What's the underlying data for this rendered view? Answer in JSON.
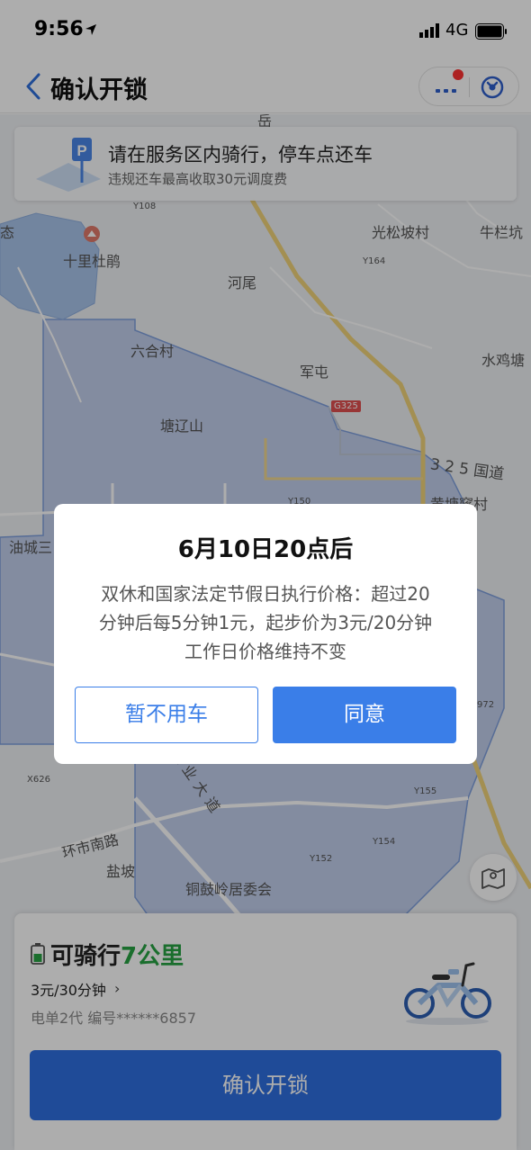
{
  "status_bar": {
    "time": "9:56",
    "network": "4G"
  },
  "nav": {
    "title": "确认开锁"
  },
  "banner": {
    "title": "请在服务区内骑行，停车点还车",
    "subtitle": "违规还车最高收取30元调度费"
  },
  "map": {
    "labels": [
      "十里杜鹃",
      "光松坡村",
      "牛栏坑",
      "河尾",
      "六合村",
      "军屯",
      "水鸡塘",
      "塘辽山",
      "油城三",
      "黄塘窿村",
      "环市南路",
      "盐坡",
      "铜鼓岭居委会",
      "工业大道",
      "3 2 5 国道",
      "态",
      "岳"
    ],
    "road_badges": [
      "Y108",
      "Y164",
      "G325",
      "Y150",
      "X626",
      "Y155",
      "Y154",
      "Y152",
      "972"
    ]
  },
  "sheet": {
    "range_prefix": "可骑行",
    "range_value": "7公里",
    "price": "3元/30分钟",
    "price_chevron": "›",
    "bike_model": "电单2代",
    "bike_number": "编号******6857",
    "confirm_label": "确认开锁"
  },
  "modal": {
    "title": "6月10日20点后",
    "body_lines": [
      "双休和国家法定节假日执行价格：超过20",
      "分钟后每5分钟1元，起步价为3元/20分钟",
      "工作日价格维持不变"
    ],
    "cancel_label": "暂不用车",
    "agree_label": "同意"
  },
  "colors": {
    "accent": "#3a7ee8",
    "confirm": "#2e6fe0",
    "range_green": "#27a243",
    "service_area": "#b8c8ea",
    "water": "#a9c4ea",
    "road": "#f1d37a"
  }
}
